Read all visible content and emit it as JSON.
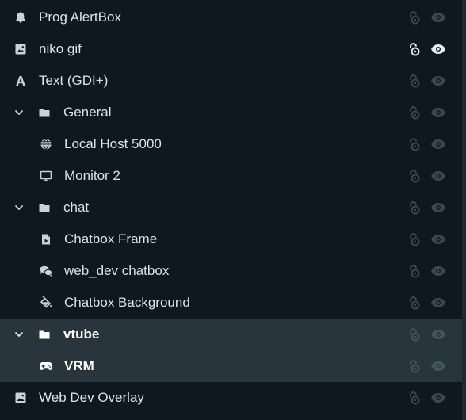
{
  "colors": {
    "background": "#0d1821",
    "selected_row": "#29353d",
    "text": "#dbe2e8",
    "icon": "#c9d2d9",
    "control_dim": "#3a4852",
    "control_active": "#e4eaee"
  },
  "sources": [
    {
      "label": "Prog AlertBox",
      "icon": "bell-icon",
      "indent": 0,
      "selected": false,
      "controls_active": false
    },
    {
      "label": "niko gif",
      "icon": "image-icon",
      "indent": 0,
      "selected": false,
      "controls_active": true
    },
    {
      "label": "Text (GDI+)",
      "icon": "text-icon",
      "indent": 0,
      "selected": false,
      "controls_active": false
    },
    {
      "label": "General",
      "icon": "folder-icon",
      "indent": 0,
      "group": true,
      "expanded": true,
      "selected": false,
      "controls_active": false
    },
    {
      "label": "Local Host 5000",
      "icon": "globe-icon",
      "indent": 1,
      "selected": false,
      "controls_active": false
    },
    {
      "label": "Monitor 2",
      "icon": "monitor-icon",
      "indent": 1,
      "selected": false,
      "controls_active": false
    },
    {
      "label": "chat",
      "icon": "folder-icon",
      "indent": 0,
      "group": true,
      "expanded": true,
      "selected": false,
      "controls_active": false
    },
    {
      "label": "Chatbox Frame",
      "icon": "media-file-icon",
      "indent": 1,
      "selected": false,
      "controls_active": false
    },
    {
      "label": "web_dev chatbox",
      "icon": "chat-bubbles-icon",
      "indent": 1,
      "selected": false,
      "controls_active": false
    },
    {
      "label": "Chatbox Background",
      "icon": "paint-bucket-icon",
      "indent": 1,
      "selected": false,
      "controls_active": false
    },
    {
      "label": "vtube",
      "icon": "folder-icon",
      "indent": 0,
      "group": true,
      "expanded": true,
      "selected": true,
      "controls_active": false
    },
    {
      "label": "VRM",
      "icon": "gamepad-icon",
      "indent": 1,
      "selected": true,
      "controls_active": false
    },
    {
      "label": "Web Dev Overlay",
      "icon": "image-icon",
      "indent": 0,
      "selected": false,
      "controls_active": false
    }
  ]
}
